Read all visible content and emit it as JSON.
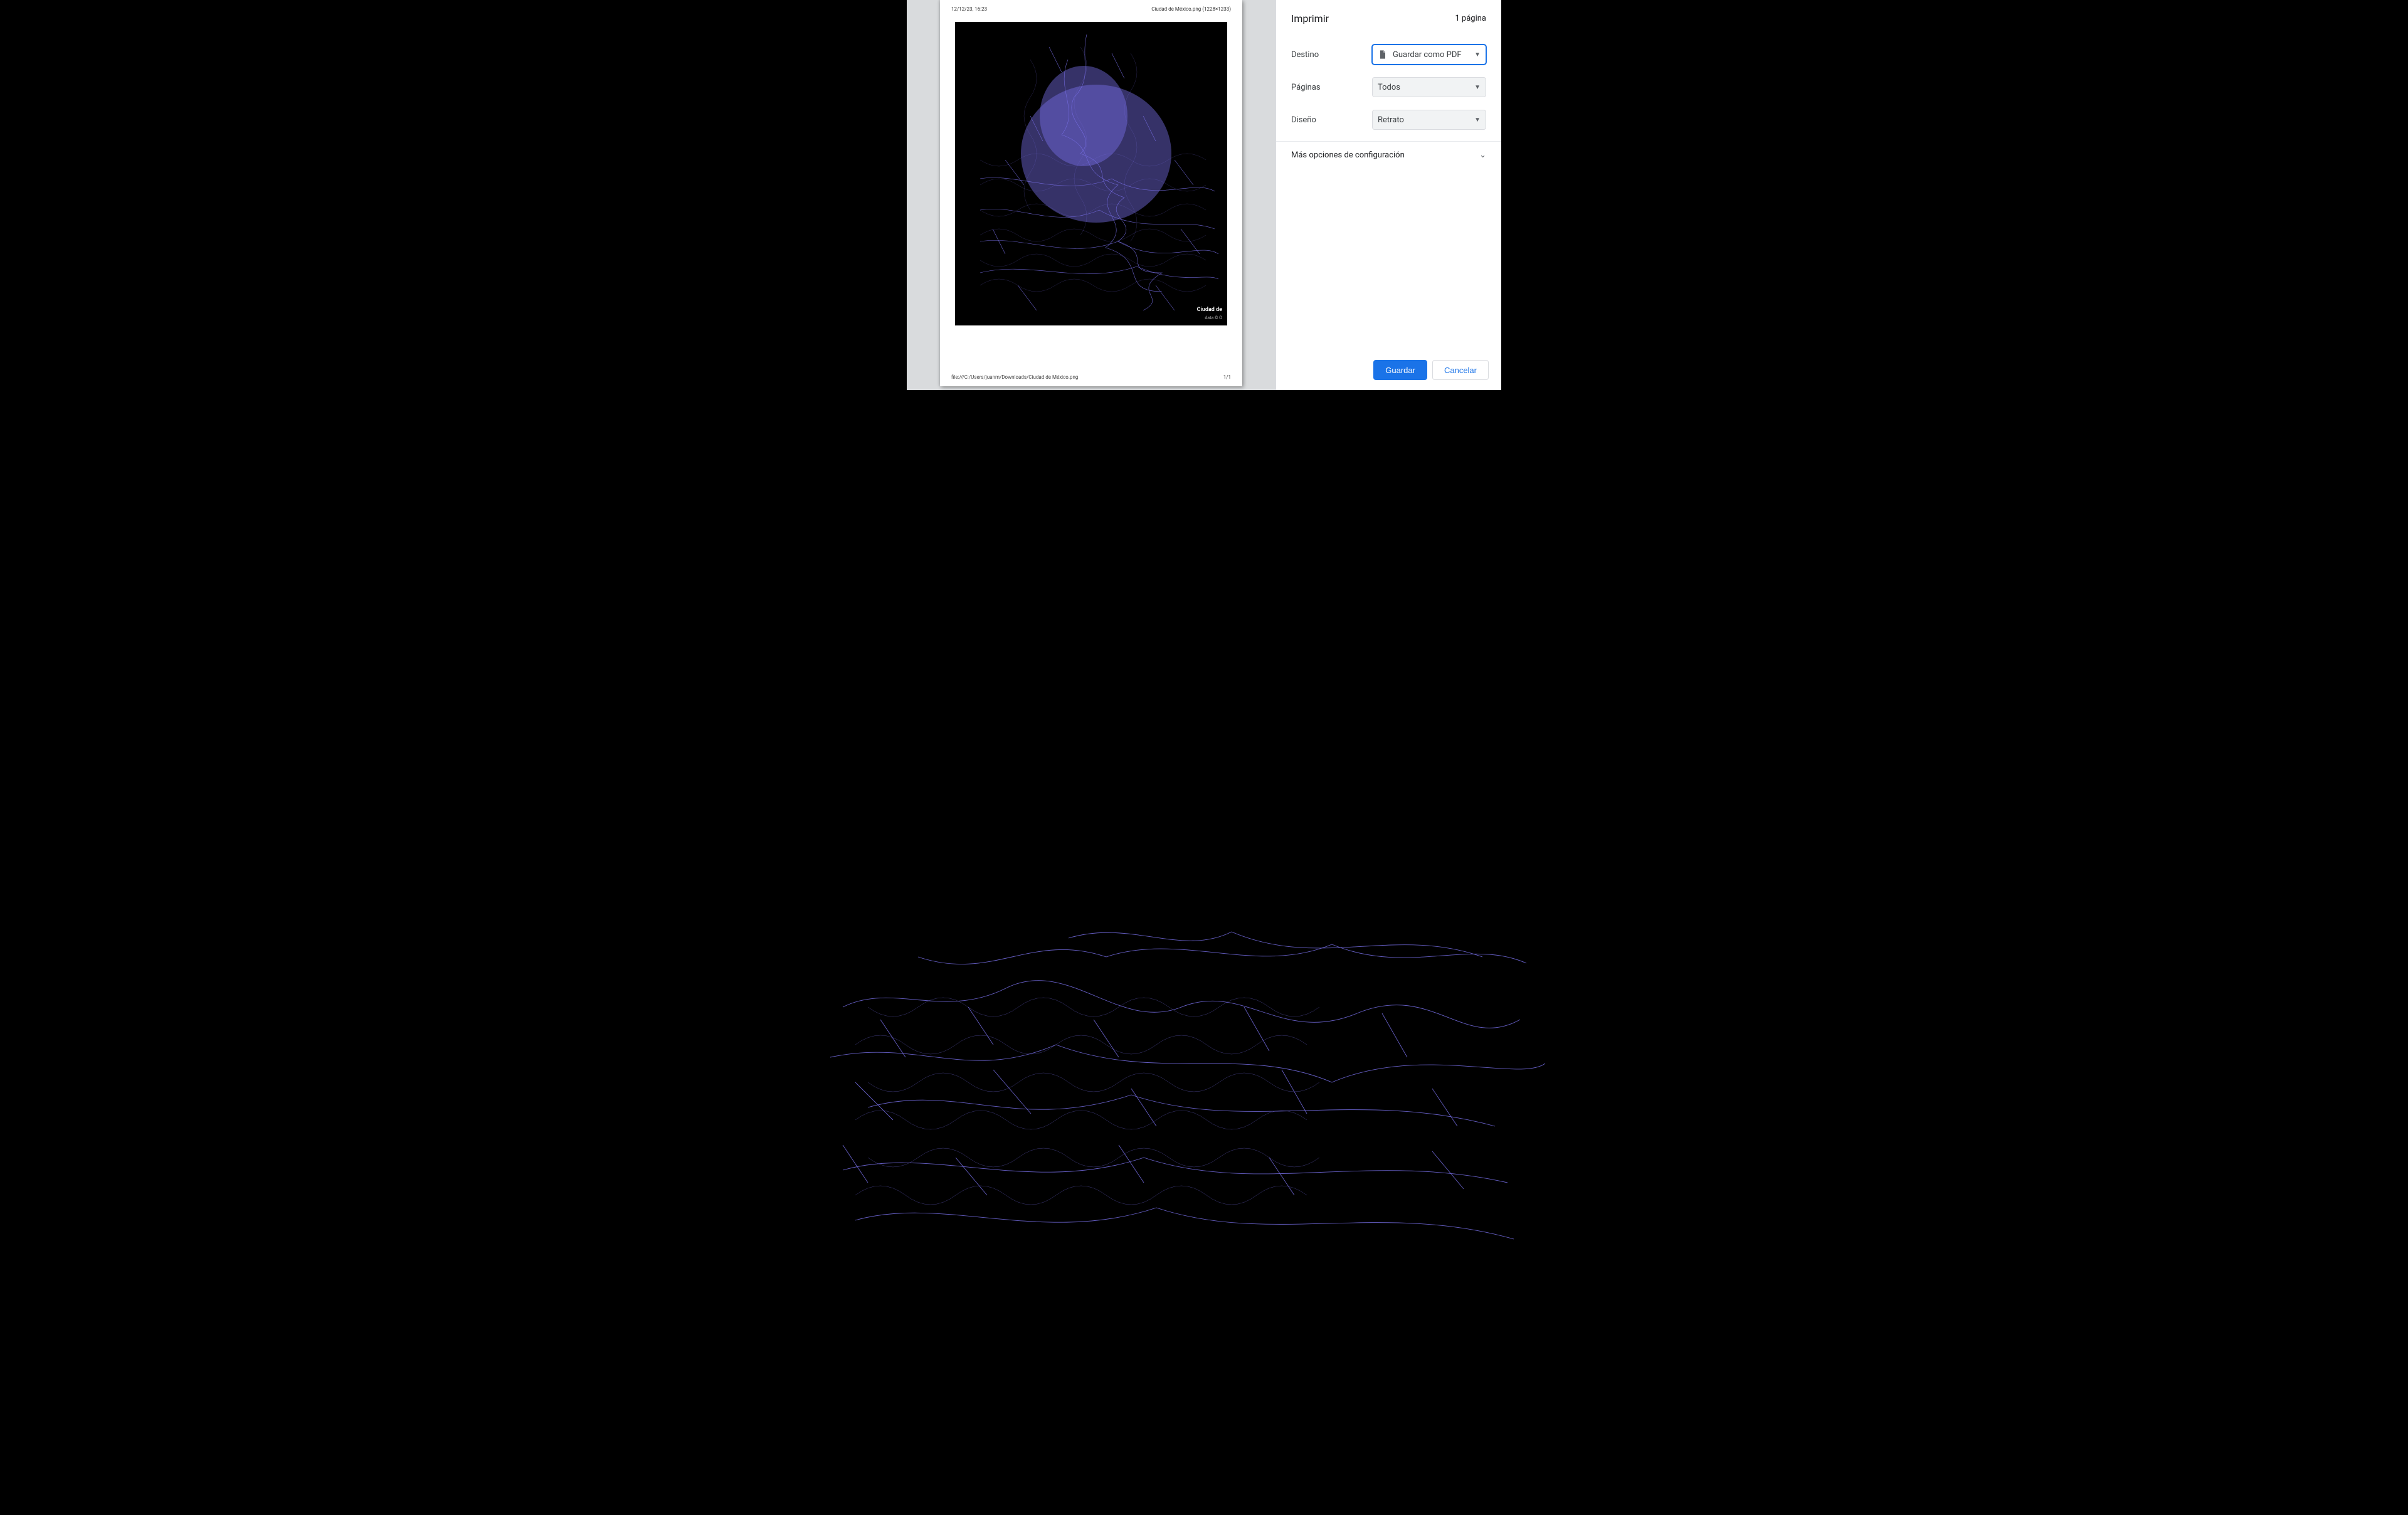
{
  "dialog": {
    "title": "Imprimir",
    "sheet_count": "1 página",
    "destination": {
      "label": "Destino",
      "value": "Guardar como PDF"
    },
    "pages": {
      "label": "Páginas",
      "value": "Todos"
    },
    "layout": {
      "label": "Diseño",
      "value": "Retrato"
    },
    "more_settings": "Más opciones de configuración",
    "save": "Guardar",
    "cancel": "Cancelar"
  },
  "preview": {
    "timestamp": "12/12/23, 16:23",
    "title": "Ciudad de México.png (1228×1233)",
    "footer_path": "file:///C:/Users/juanm/Downloads/Ciudad de México.png",
    "footer_page": "1/1",
    "city_label": "Ciudad de",
    "credit": "data © O"
  }
}
